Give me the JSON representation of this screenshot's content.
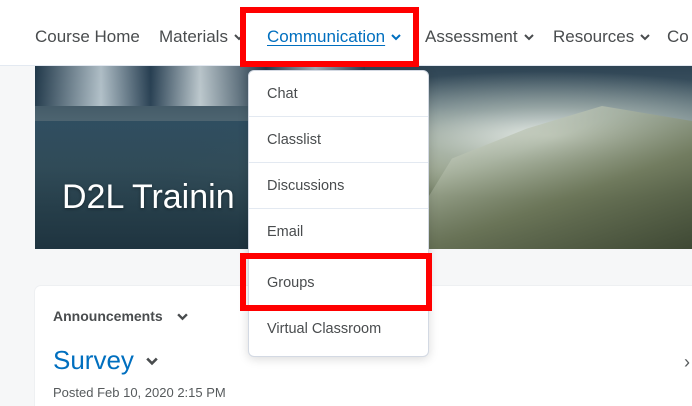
{
  "nav": {
    "items": [
      {
        "label": "Course Home",
        "has_chevron": false
      },
      {
        "label": "Materials",
        "has_chevron": true
      },
      {
        "label": "Communication",
        "has_chevron": true,
        "active": true
      },
      {
        "label": "Assessment",
        "has_chevron": true
      },
      {
        "label": "Resources",
        "has_chevron": true
      },
      {
        "label": "Co",
        "has_chevron": false
      }
    ]
  },
  "banner": {
    "title": "D2L Trainin"
  },
  "dropdown": {
    "items": [
      "Chat",
      "Classlist",
      "Discussions",
      "Email",
      "Groups",
      "Virtual Classroom"
    ]
  },
  "announcements": {
    "header": "Announcements",
    "title": "Survey",
    "posted": "Posted Feb 10, 2020 2:15 PM"
  },
  "colors": {
    "link": "#006fbf",
    "highlight": "#ff0000",
    "nav_text": "#494c4e"
  }
}
